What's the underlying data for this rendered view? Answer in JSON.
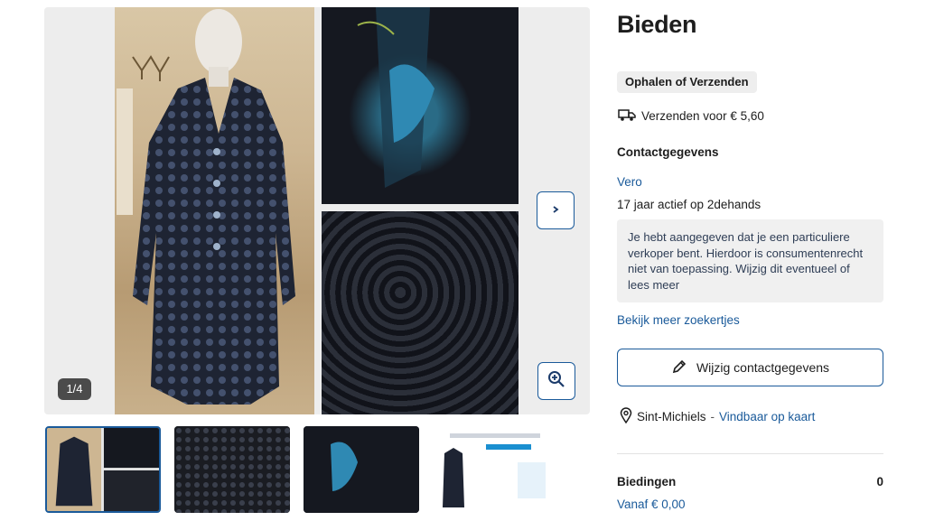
{
  "gallery": {
    "counter": "1/4",
    "images": [
      "coat-on-mannequin",
      "collar-detail",
      "fabric-pattern-detail"
    ],
    "thumbnail_count": 4
  },
  "sidebar": {
    "title": "Bieden",
    "delivery_pill": "Ophalen of Verzenden",
    "shipping_text": "Verzenden voor € 5,60",
    "contact_heading": "Contactgegevens",
    "seller_name": "Vero",
    "active_years": "17 jaar actief op 2dehands",
    "private_note": "Je hebt aangegeven dat je een particuliere verkoper bent. Hierdoor is consumentenrecht niet van toepassing. Wijzig dit eventueel of lees meer",
    "more_ads_link": "Bekijk meer zoekertjes",
    "edit_button": "Wijzig contactgegevens",
    "location": "Sint-Michiels",
    "location_separator": "-",
    "map_link": "Vindbaar op kaart",
    "bids_label": "Biedingen",
    "bids_count": "0",
    "bids_from": "Vanaf € 0,00"
  },
  "colors": {
    "accent": "#1a5a9a",
    "pill_bg": "#eeeeee",
    "note_bg": "#f0f0f0"
  }
}
